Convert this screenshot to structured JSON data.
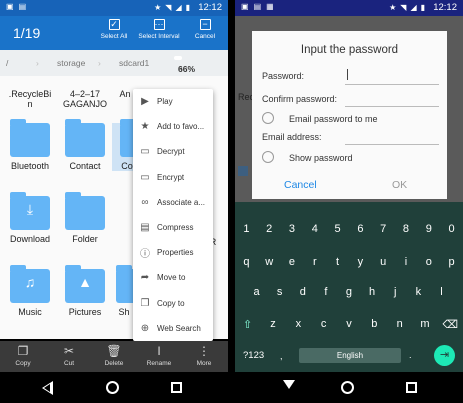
{
  "status": {
    "time": "12:12"
  },
  "file_manager": {
    "selection_count": "1/19",
    "actions": {
      "select_all": "Select All",
      "select_interval": "Select Interval",
      "cancel": "Cancel"
    },
    "path": {
      "root": "/",
      "storage": "storage",
      "sdcard": "sdcard1",
      "usage": "66%"
    },
    "folders": [
      {
        "name": ".RecycleBin",
        "label": ".RecycleBi\nn"
      },
      {
        "name": "4-2-17 GAGANJO",
        "label": "4–2–17\nGAGANJO"
      },
      {
        "name": "An",
        "label": "An"
      },
      {
        "name": "Bluetooth",
        "label": "Bluetooth"
      },
      {
        "name": "Contact",
        "label": "Contact"
      },
      {
        "name": "Co",
        "label": "Co"
      },
      {
        "name": "Download",
        "label": "Download"
      },
      {
        "name": "Folder",
        "label": "Folder"
      },
      {
        "name": "R",
        "label": "R"
      },
      {
        "name": "Music",
        "label": "Music"
      },
      {
        "name": "Pictures",
        "label": "Pictures"
      },
      {
        "name": "Sh",
        "label": "Sh"
      }
    ],
    "context_menu": [
      "Play",
      "Add to favo...",
      "Decrypt",
      "Encrypt",
      "Associate a...",
      "Compress",
      "Properties",
      "Move to",
      "Copy to",
      "Web Search"
    ],
    "bottom_bar": [
      "Copy",
      "Cut",
      "Delete",
      "Rename",
      "More"
    ]
  },
  "password_dialog": {
    "title": "Input the password",
    "password_label": "Password:",
    "confirm_label": "Confirm password:",
    "email_option": "Email password to me",
    "email_label": "Email address:",
    "show_password": "Show password",
    "cancel": "Cancel",
    "ok": "OK",
    "background_text": "RecycleBin"
  },
  "keyboard": {
    "numbers": [
      "1",
      "2",
      "3",
      "4",
      "5",
      "6",
      "7",
      "8",
      "9",
      "0"
    ],
    "row1": [
      "q",
      "w",
      "e",
      "r",
      "t",
      "y",
      "u",
      "i",
      "o",
      "p"
    ],
    "row2": [
      "a",
      "s",
      "d",
      "f",
      "g",
      "h",
      "j",
      "k",
      "l"
    ],
    "row3": [
      "z",
      "x",
      "c",
      "v",
      "b",
      "n",
      "m"
    ],
    "symbols_key": "?123",
    "space_label": "English"
  }
}
